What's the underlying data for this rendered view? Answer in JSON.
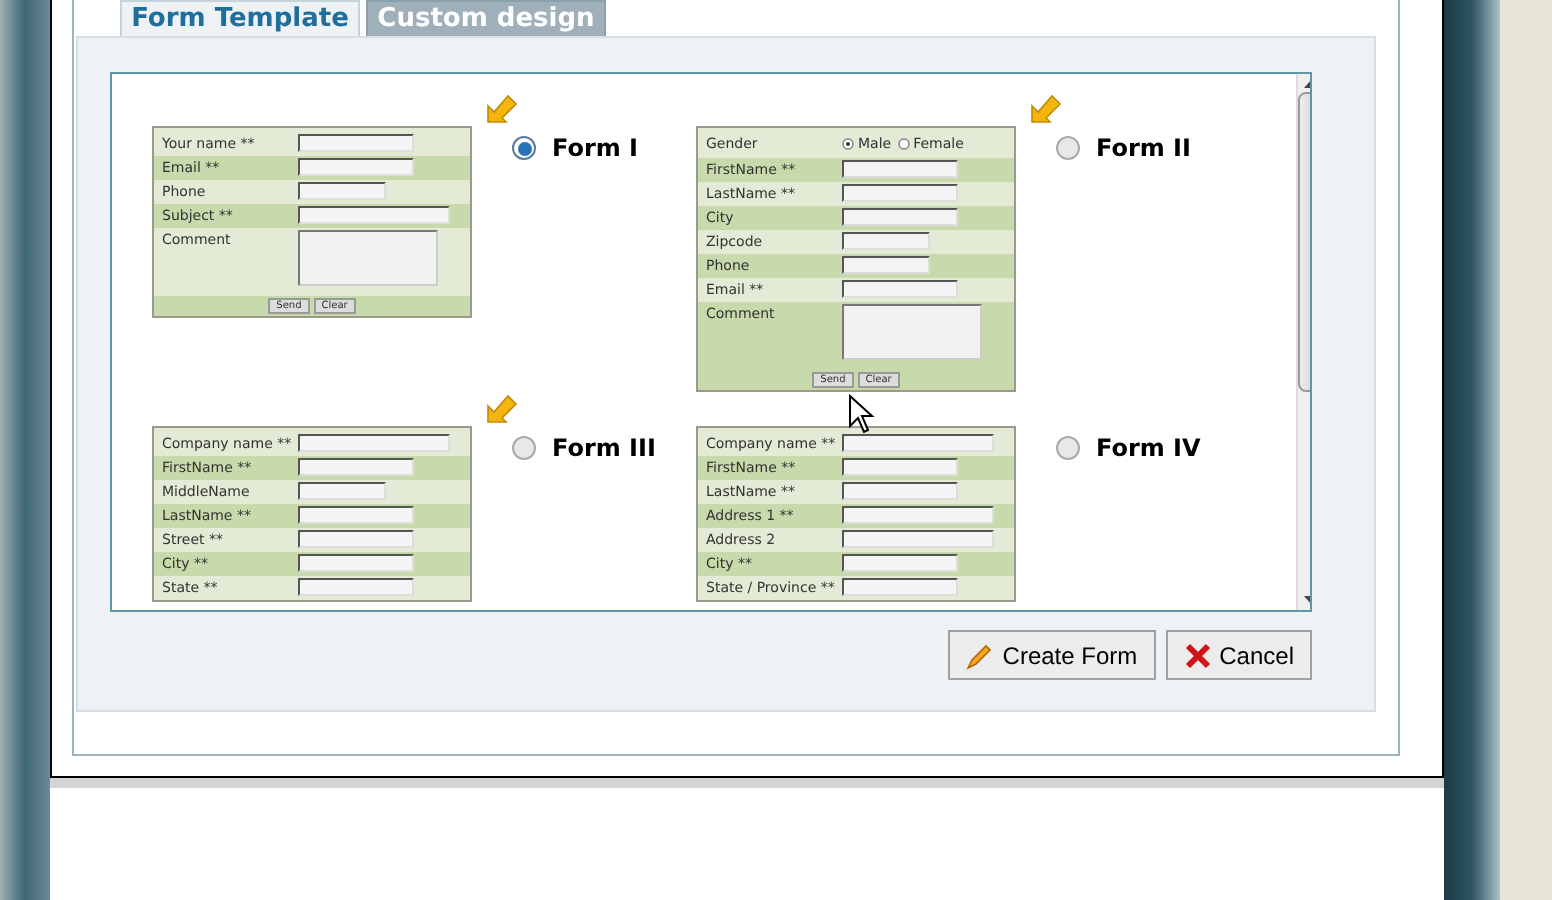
{
  "tabs": [
    {
      "label": "Form Template",
      "selected": true
    },
    {
      "label": "Custom design",
      "selected": false
    }
  ],
  "forms": [
    {
      "label": "Form I",
      "selected": true,
      "highlighted": true,
      "rows": [
        {
          "kind": "text",
          "label": "Your name **"
        },
        {
          "kind": "text",
          "label": "Email **"
        },
        {
          "kind": "short",
          "label": "Phone"
        },
        {
          "kind": "long",
          "label": "Subject **"
        },
        {
          "kind": "textarea",
          "label": "Comment"
        }
      ],
      "buttons": [
        "Send",
        "Clear"
      ]
    },
    {
      "label": "Form II",
      "selected": false,
      "highlighted": true,
      "rows": [
        {
          "kind": "radio",
          "label": "Gender",
          "options": [
            {
              "label": "Male",
              "selected": true
            },
            {
              "label": "Female",
              "selected": false
            }
          ]
        },
        {
          "kind": "text",
          "label": "FirstName **"
        },
        {
          "kind": "text",
          "label": "LastName **"
        },
        {
          "kind": "text",
          "label": "City"
        },
        {
          "kind": "short",
          "label": "Zipcode"
        },
        {
          "kind": "short",
          "label": "Phone"
        },
        {
          "kind": "text",
          "label": "Email **"
        },
        {
          "kind": "textarea",
          "label": "Comment"
        }
      ],
      "buttons": [
        "Send",
        "Clear"
      ]
    },
    {
      "label": "Form III",
      "selected": false,
      "highlighted": true,
      "rows": [
        {
          "kind": "long",
          "label": "Company name **"
        },
        {
          "kind": "text",
          "label": "FirstName **"
        },
        {
          "kind": "short",
          "label": "MiddleName"
        },
        {
          "kind": "text",
          "label": "LastName **"
        },
        {
          "kind": "text",
          "label": "Street **"
        },
        {
          "kind": "text",
          "label": "City **"
        },
        {
          "kind": "text",
          "label": "State **"
        }
      ]
    },
    {
      "label": "Form IV",
      "selected": false,
      "highlighted": false,
      "rows": [
        {
          "kind": "long",
          "label": "Company name **"
        },
        {
          "kind": "text",
          "label": "FirstName **"
        },
        {
          "kind": "text",
          "label": "LastName **"
        },
        {
          "kind": "long",
          "label": "Address 1 **"
        },
        {
          "kind": "long",
          "label": "Address 2"
        },
        {
          "kind": "text",
          "label": "City **"
        },
        {
          "kind": "text",
          "label": "State / Province **"
        }
      ]
    }
  ],
  "buttons": [
    {
      "kind": "create",
      "label": "Create Form"
    },
    {
      "kind": "cancel",
      "label": "Cancel"
    }
  ]
}
